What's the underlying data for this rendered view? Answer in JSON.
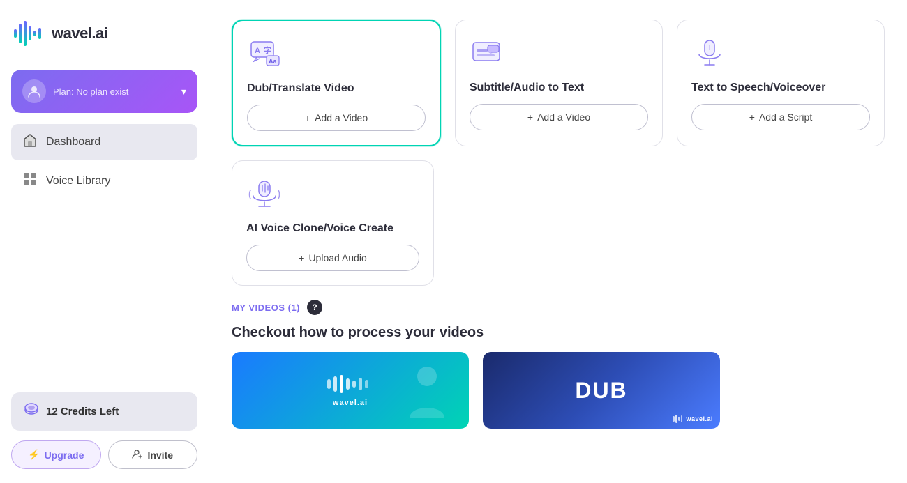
{
  "brand": {
    "logo_text": "wavel.ai",
    "logo_text_prefix": "wavel"
  },
  "sidebar": {
    "user": {
      "plan_label": "Plan: No plan exist",
      "avatar_icon": "user-icon"
    },
    "nav_items": [
      {
        "id": "dashboard",
        "label": "Dashboard",
        "icon": "home-icon",
        "active": true
      },
      {
        "id": "voice-library",
        "label": "Voice Library",
        "icon": "grid-icon",
        "active": false
      }
    ],
    "credits": {
      "label": "12 Credits Left",
      "icon": "credits-icon"
    },
    "upgrade_label": "Upgrade",
    "invite_label": "Invite"
  },
  "main": {
    "feature_cards": [
      {
        "id": "dub-translate",
        "title": "Dub/Translate Video",
        "action_label": "+ Add a Video",
        "selected": true,
        "icon": "dub-icon"
      },
      {
        "id": "subtitle-audio",
        "title": "Subtitle/Audio to Text",
        "action_label": "+ Add a Video",
        "selected": false,
        "icon": "subtitle-icon"
      },
      {
        "id": "tts",
        "title": "Text to Speech/Voiceover",
        "action_label": "+ Add a Script",
        "selected": false,
        "icon": "tts-icon"
      }
    ],
    "second_row_cards": [
      {
        "id": "voice-clone",
        "title": "AI Voice Clone/Voice Create",
        "action_label": "+ Upload Audio",
        "selected": false,
        "icon": "voice-clone-icon"
      }
    ],
    "my_videos": {
      "label": "MY VIDEOS (1)",
      "info_icon": "?"
    },
    "checkout_text": "Checkout how to process your videos",
    "video_thumbnails": [
      {
        "id": "thumb1",
        "type": "blue",
        "label": "wavel.ai"
      },
      {
        "id": "thumb2",
        "type": "dark",
        "big_text": "DUB",
        "label": "wavel.ai"
      }
    ]
  }
}
